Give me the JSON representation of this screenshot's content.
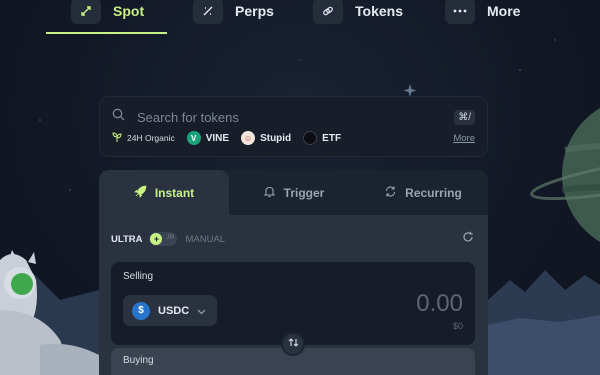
{
  "nav": {
    "items": [
      {
        "label": "Spot",
        "icon": "swap-arrows-icon"
      },
      {
        "label": "Perps",
        "icon": "perps-icon"
      },
      {
        "label": "Tokens",
        "icon": "link-icon"
      },
      {
        "label": "More",
        "icon": "dots-icon"
      }
    ],
    "active_color": "#c7f284"
  },
  "search": {
    "placeholder": "Search for tokens",
    "shortcut": "⌘/",
    "chips": [
      {
        "label": "24H Organic",
        "icon": "sprout-icon"
      },
      {
        "label": "VINE",
        "icon": "vine-icon"
      },
      {
        "label": "Stupid",
        "icon": "stupid-token-icon"
      },
      {
        "label": "ETF",
        "icon": "etf-token-icon"
      }
    ],
    "more_label": "More"
  },
  "tabs": [
    {
      "label": "Instant",
      "icon": "rocket-icon"
    },
    {
      "label": "Trigger",
      "icon": "bell-icon"
    },
    {
      "label": "Recurring",
      "icon": "recurring-icon"
    }
  ],
  "mode": {
    "ultra_label": "ULTRA",
    "toggle_off_text": "JR",
    "manual_label": "MANUAL"
  },
  "selling": {
    "label": "Selling",
    "token": "USDC",
    "token_icon_text": "$",
    "amount": "0.00",
    "usd_value": "$0"
  },
  "buying": {
    "label": "Buying"
  }
}
